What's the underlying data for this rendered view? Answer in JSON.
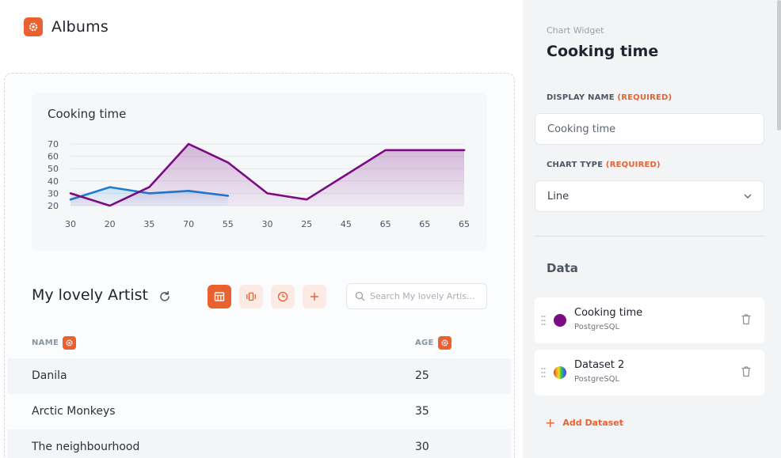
{
  "app": {
    "title": "Albums"
  },
  "chart_widget": {
    "title": "Cooking time",
    "chart_data": {
      "type": "line",
      "categories": [
        "30",
        "20",
        "35",
        "70",
        "55",
        "30",
        "25",
        "45",
        "65",
        "65",
        "65"
      ],
      "y_ticks": [
        20,
        30,
        40,
        50,
        60,
        70
      ],
      "ylim": [
        20,
        70
      ],
      "grid": true,
      "legend": "none",
      "series": [
        {
          "values": [
            30,
            20,
            35,
            70,
            55,
            30,
            25,
            45,
            65,
            65,
            65
          ],
          "color": "#7b0b82",
          "fill": true
        },
        {
          "values": [
            25,
            35,
            30,
            32,
            28
          ],
          "color": "#1a7fd0",
          "fill": true
        }
      ]
    }
  },
  "table": {
    "title": "My lovely Artist",
    "search_placeholder": "Search My lovely Artis...",
    "columns": [
      "NAME",
      "AGE"
    ],
    "rows": [
      {
        "name": "Danila",
        "age": "25"
      },
      {
        "name": "Arctic Monkeys",
        "age": "35"
      },
      {
        "name": "The neighbourhood",
        "age": "30"
      }
    ]
  },
  "panel": {
    "kicker": "Chart Widget",
    "heading": "Cooking time",
    "display_name_label": "DISPLAY NAME",
    "required_label": "(REQUIRED)",
    "display_name_value": "Cooking time",
    "chart_type_label": "CHART TYPE",
    "chart_type_value": "Line",
    "data_heading": "Data",
    "datasets": [
      {
        "name": "Cooking time",
        "source": "PostgreSQL",
        "color": "#7b0b82"
      },
      {
        "name": "Dataset 2",
        "source": "PostgreSQL",
        "color": "rainbow"
      }
    ],
    "add_dataset_label": "Add Dataset"
  },
  "colors": {
    "accent": "#e9612f",
    "line_primary": "#7b0b82",
    "line_secondary": "#1a7fd0"
  }
}
